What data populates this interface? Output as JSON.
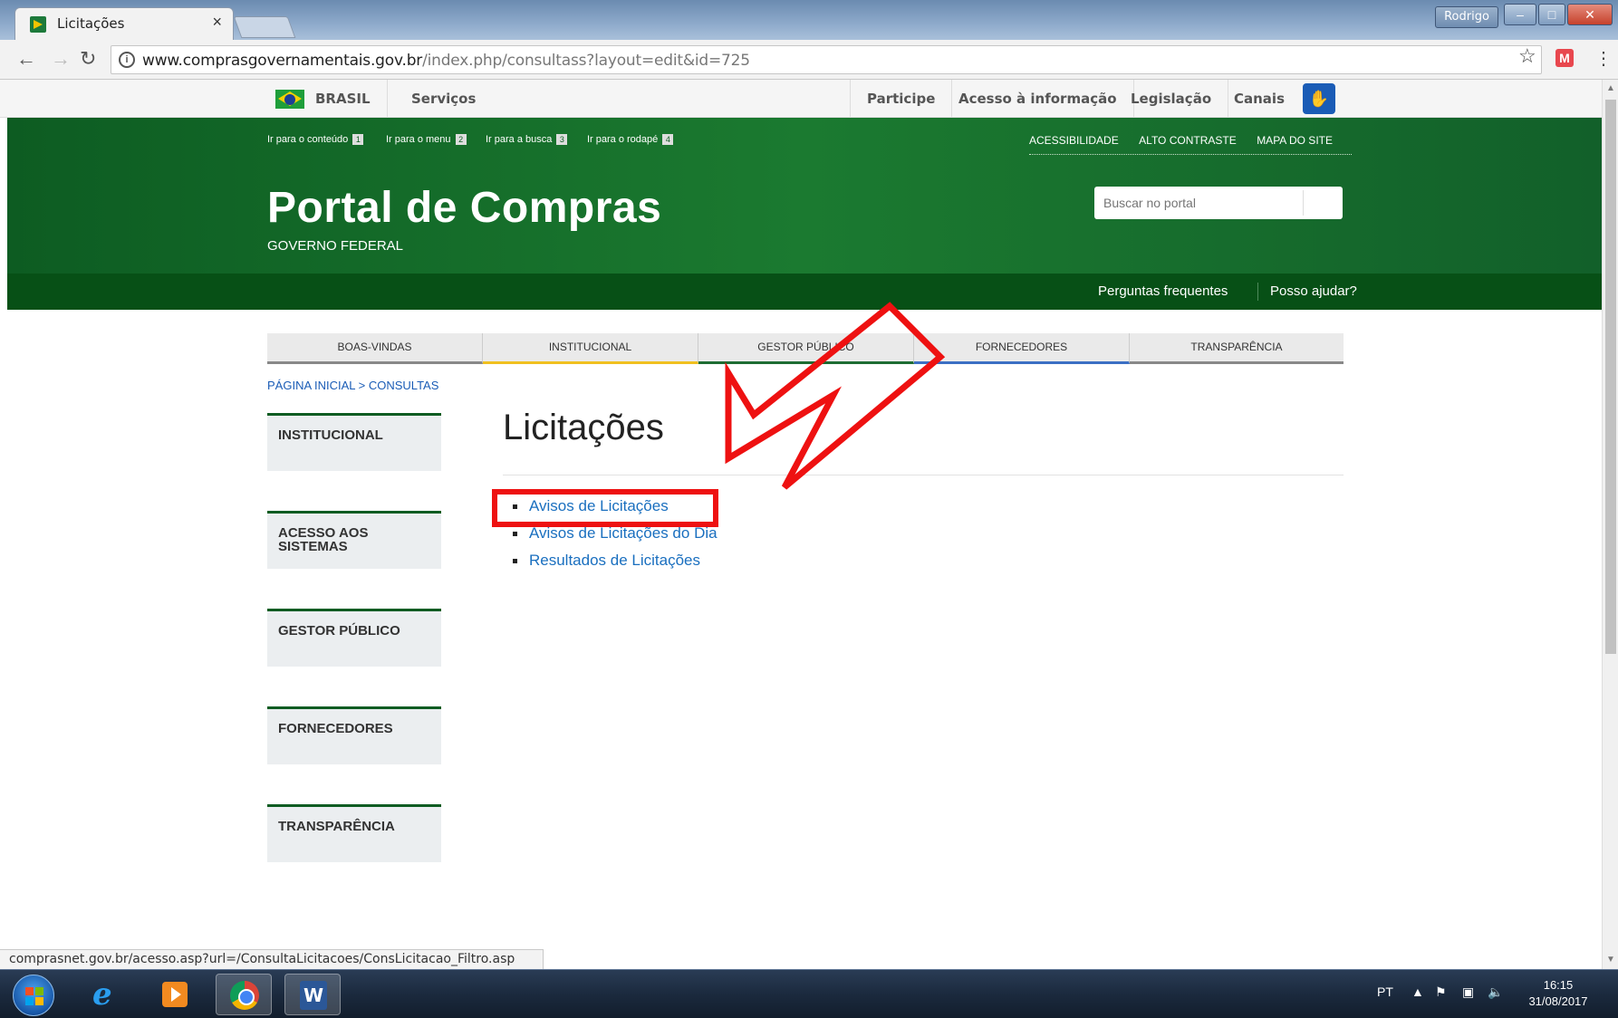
{
  "browser": {
    "tab_title": "Licitações",
    "tab_close": "×",
    "user_label": "Rodrigo",
    "url_host": "www.comprasgovernamentais.gov.br",
    "url_path": "/index.php/consultass?layout=edit&id=725",
    "status_url": "comprasnet.gov.br/acesso.asp?url=/ConsultaLicitacoes/ConsLicitacao_Filtro.asp"
  },
  "govbar": {
    "brasil": "BRASIL",
    "servicos": "Serviços",
    "participe": "Participe",
    "acesso": "Acesso à informação",
    "legislacao": "Legislação",
    "canais": "Canais"
  },
  "header": {
    "skip_links": [
      {
        "label": "Ir para o conteúdo",
        "num": "1"
      },
      {
        "label": "Ir para o menu",
        "num": "2"
      },
      {
        "label": "Ir para a busca",
        "num": "3"
      },
      {
        "label": "Ir para o rodapé",
        "num": "4"
      }
    ],
    "acc_links": [
      "ACESSIBILIDADE",
      "ALTO CONTRASTE",
      "MAPA DO SITE"
    ],
    "title": "Portal de Compras",
    "subtitle": "GOVERNO FEDERAL",
    "search_placeholder": "Buscar no portal",
    "faq": "Perguntas frequentes",
    "help": "Posso ajudar?"
  },
  "mainnav": [
    "BOAS-VINDAS",
    "INSTITUCIONAL",
    "GESTOR PÚBLICO",
    "FORNECEDORES",
    "TRANSPARÊNCIA"
  ],
  "breadcrumb": "PÁGINA INICIAL > CONSULTAS",
  "sidemenu": [
    "INSTITUCIONAL",
    "ACESSO AOS SISTEMAS",
    "GESTOR PÚBLICO",
    "FORNECEDORES",
    "TRANSPARÊNCIA"
  ],
  "content": {
    "title": "Licitações",
    "links": [
      "Avisos de Licitações",
      "Avisos de Licitações do Dia",
      "Resultados de Licitações"
    ]
  },
  "taskbar": {
    "lang": "PT",
    "time": "16:15",
    "date": "31/08/2017"
  },
  "colors": {
    "header_green": "#1b7a30",
    "highlight_red": "#ee1111",
    "link_blue": "#1a6fbf"
  }
}
